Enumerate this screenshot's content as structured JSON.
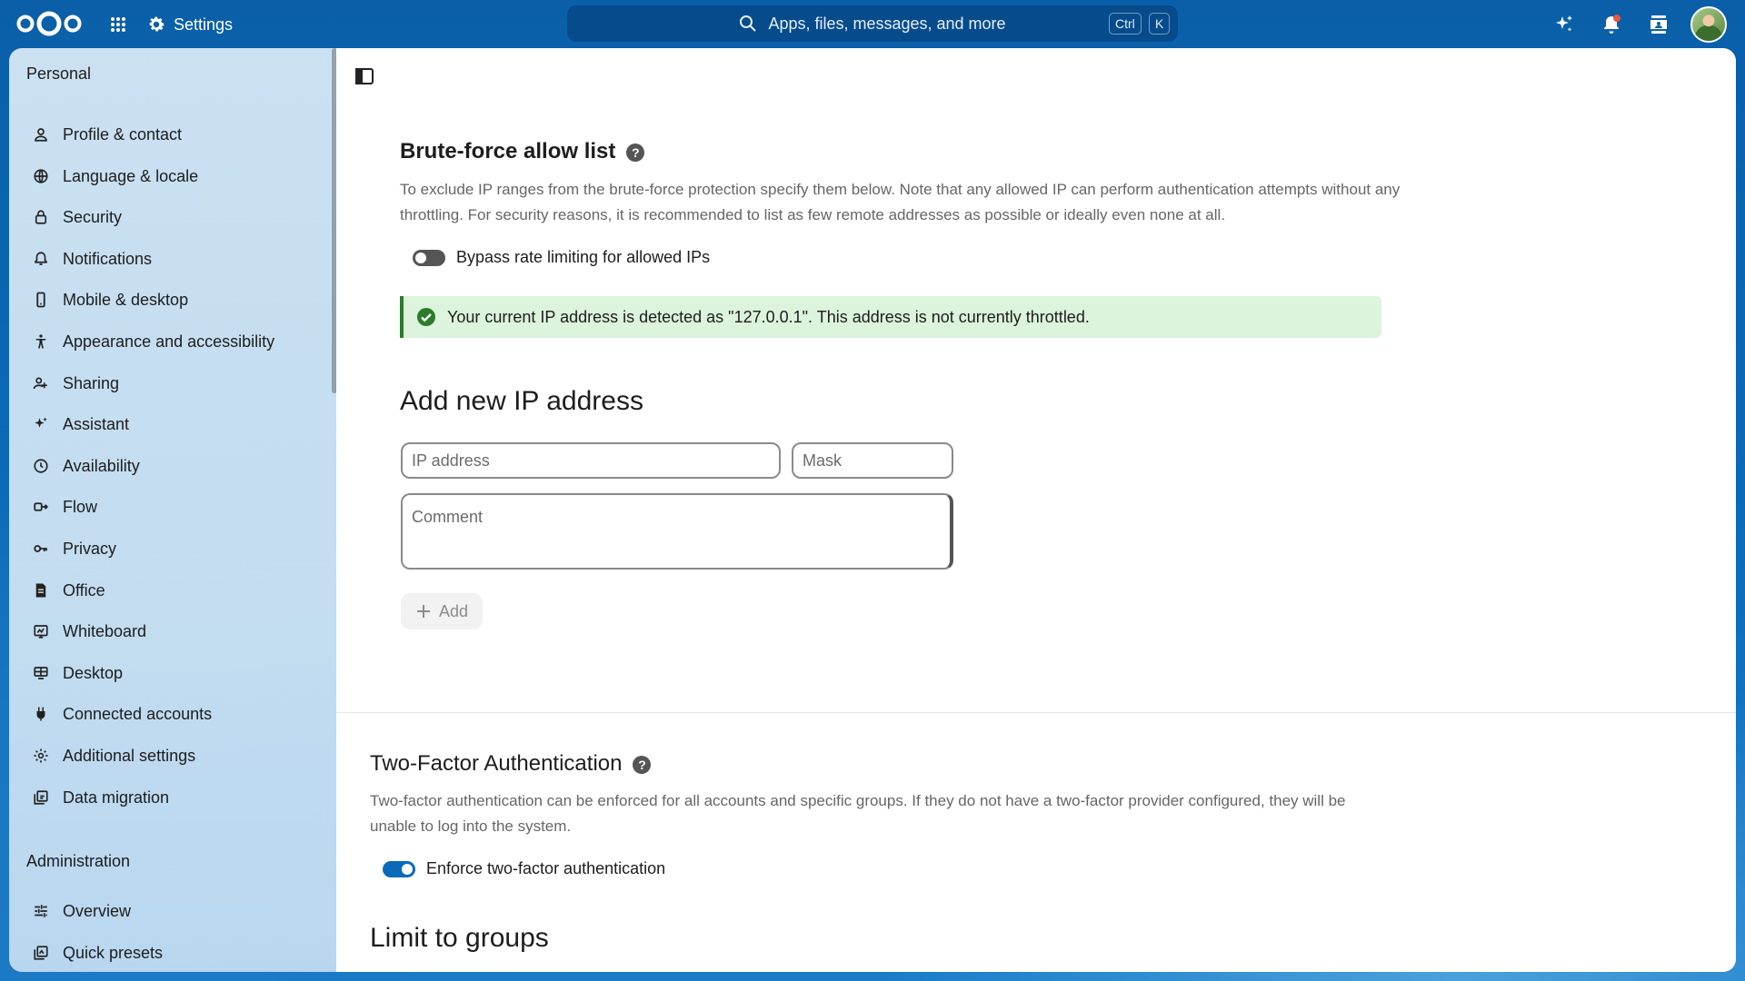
{
  "header": {
    "app_title": "Settings",
    "search_placeholder": "Apps, files, messages, and more",
    "shortcut_keys": [
      "Ctrl",
      "K"
    ],
    "icons": [
      "nextcloud-logo",
      "apps-grid-icon",
      "gear-icon",
      "search-icon",
      "assistant-sparkle-icon",
      "notifications-bell-icon",
      "contacts-icon",
      "user-avatar"
    ]
  },
  "sidebar": {
    "personal_title": "Personal",
    "personal_items": [
      {
        "label": "Profile & contact",
        "icon": "user-icon"
      },
      {
        "label": "Language & locale",
        "icon": "globe-icon"
      },
      {
        "label": "Security",
        "icon": "lock-icon"
      },
      {
        "label": "Notifications",
        "icon": "bell-icon"
      },
      {
        "label": "Mobile & desktop",
        "icon": "phone-icon"
      },
      {
        "label": "Appearance and accessibility",
        "icon": "accessibility-icon"
      },
      {
        "label": "Sharing",
        "icon": "share-icon"
      },
      {
        "label": "Assistant",
        "icon": "sparkle-icon"
      },
      {
        "label": "Availability",
        "icon": "clock-icon"
      },
      {
        "label": "Flow",
        "icon": "flow-icon"
      },
      {
        "label": "Privacy",
        "icon": "key-icon"
      },
      {
        "label": "Office",
        "icon": "document-icon"
      },
      {
        "label": "Whiteboard",
        "icon": "whiteboard-icon"
      },
      {
        "label": "Desktop",
        "icon": "desktop-icon"
      },
      {
        "label": "Connected accounts",
        "icon": "plug-icon"
      },
      {
        "label": "Additional settings",
        "icon": "gear-icon"
      },
      {
        "label": "Data migration",
        "icon": "migration-icon"
      }
    ],
    "admin_title": "Administration",
    "admin_items": [
      {
        "label": "Overview",
        "icon": "tune-icon"
      },
      {
        "label": "Quick presets",
        "icon": "presets-icon"
      }
    ]
  },
  "bruteforce": {
    "title": "Brute-force allow list",
    "description": "To exclude IP ranges from the brute-force protection specify them below. Note that any allowed IP can perform authentication attempts without any throttling. For security reasons, it is recommended to list as few remote addresses as possible or ideally even none at all.",
    "bypass_label": "Bypass rate limiting for allowed IPs",
    "bypass_enabled": false,
    "notice": "Your current IP address is detected as \"127.0.0.1\". This address is not currently throttled.",
    "add_title": "Add new IP address",
    "ip_placeholder": "IP address",
    "mask_placeholder": "Mask",
    "comment_placeholder": "Comment",
    "add_label": "Add"
  },
  "twofactor": {
    "title": "Two-Factor Authentication",
    "description": "Two-factor authentication can be enforced for all accounts and specific groups. If they do not have a two-factor provider configured, they will be unable to log into the system.",
    "enforce_label": "Enforce two-factor authentication",
    "enforce_enabled": true,
    "limit_title": "Limit to groups"
  },
  "colors": {
    "accent": "#0b6ab8",
    "success_bg": "#dcf3dc",
    "success": "#2d7b2d",
    "toggle_off": "#555555"
  }
}
